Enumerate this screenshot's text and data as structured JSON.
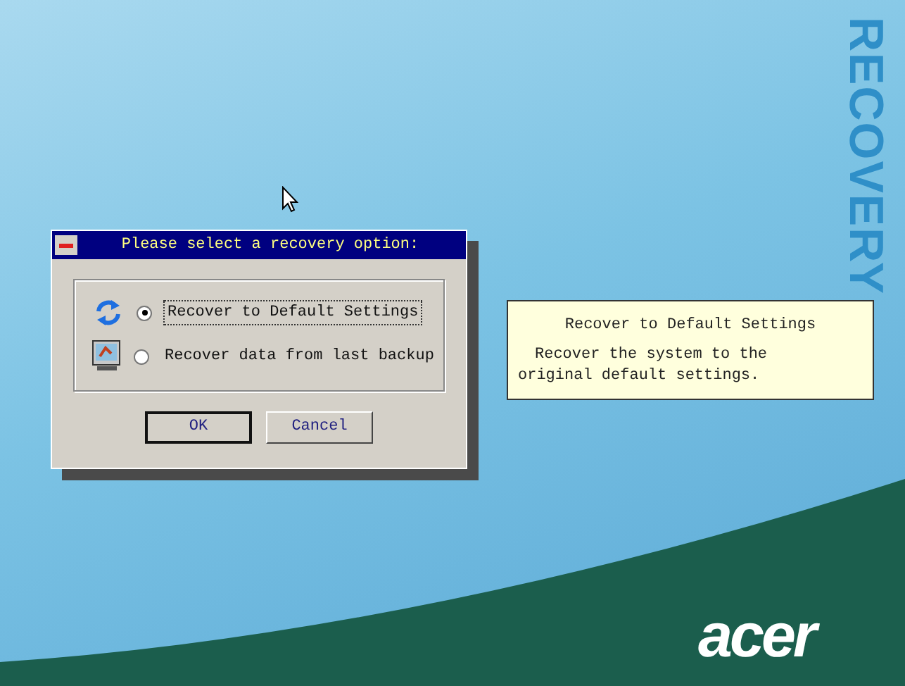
{
  "dialog": {
    "title": "Please select a recovery option:",
    "options": [
      {
        "kind": "restore",
        "label": "Recover to Default Settings",
        "selected": true
      },
      {
        "kind": "backup",
        "label": "Recover data from last backup",
        "selected": false
      }
    ],
    "buttons": [
      "OK",
      "Cancel"
    ]
  },
  "info_panel": {
    "title": "Recover to Default Settings",
    "description": "Recover the system to the original default settings."
  },
  "brand_text": "RECOVERY",
  "logo": "acer"
}
